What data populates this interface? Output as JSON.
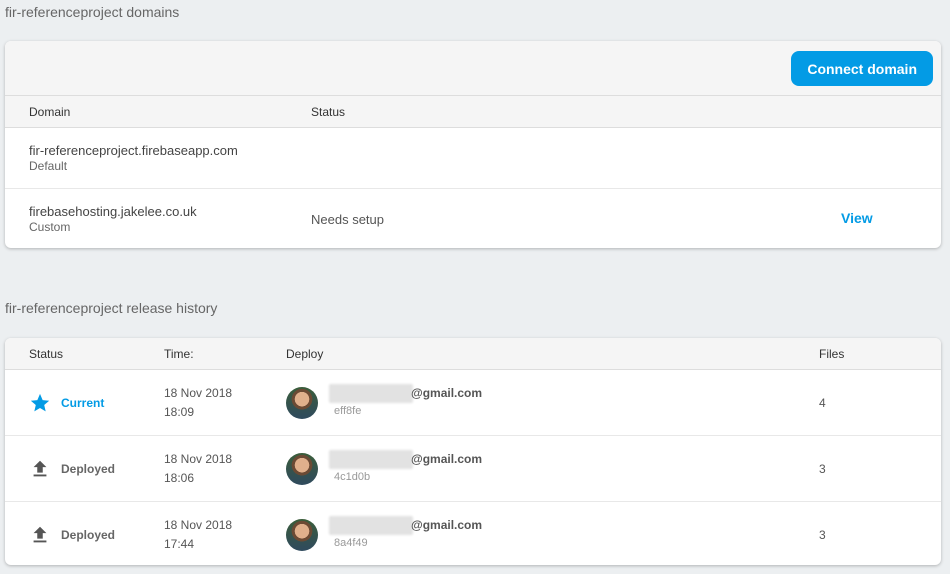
{
  "domains": {
    "section_title": "fir-referenceproject domains",
    "connect_label": "Connect domain",
    "columns": {
      "domain": "Domain",
      "status": "Status"
    },
    "rows": [
      {
        "name": "fir-referenceproject.firebaseapp.com",
        "type": "Default",
        "status": "",
        "action": ""
      },
      {
        "name": "firebasehosting.jakelee.co.uk",
        "type": "Custom",
        "status": "Needs setup",
        "action": "View"
      }
    ]
  },
  "releases": {
    "section_title": "fir-referenceproject release history",
    "columns": {
      "status": "Status",
      "time": "Time:",
      "deploy": "Deploy",
      "files": "Files"
    },
    "rows": [
      {
        "status": "Current",
        "icon": "star-icon",
        "date": "18 Nov 2018",
        "time": "18:09",
        "email": "@gmail.com",
        "hash": "eff8fe",
        "files": "4"
      },
      {
        "status": "Deployed",
        "icon": "upload-icon",
        "date": "18 Nov 2018",
        "time": "18:06",
        "email": "@gmail.com",
        "hash": "4c1d0b",
        "files": "3"
      },
      {
        "status": "Deployed",
        "icon": "upload-icon",
        "date": "18 Nov 2018",
        "time": "17:44",
        "email": "@gmail.com",
        "hash": "8a4f49",
        "files": "3"
      }
    ]
  },
  "colors": {
    "accent": "#039be5",
    "background": "#eceff1"
  }
}
